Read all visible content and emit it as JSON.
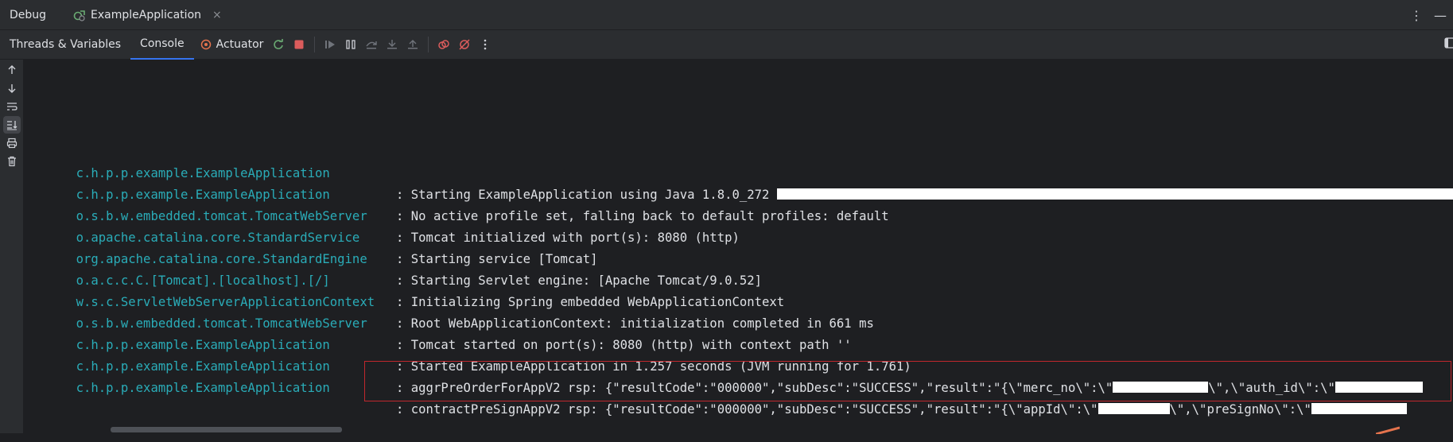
{
  "header": {
    "title": "Debug",
    "tab_label": "ExampleApplication",
    "tab_close": "×"
  },
  "toolbar": {
    "tabs": [
      "Threads & Variables",
      "Console"
    ],
    "actuator_label": "Actuator"
  },
  "console": {
    "lines": [
      {
        "logger": "c.h.p.p.example.ExampleApplication",
        "message": ": Starting ExampleApplication using Java 1.8.0_272 "
      },
      {
        "logger": "c.h.p.p.example.ExampleApplication",
        "message": ": No active profile set, falling back to default profiles: default"
      },
      {
        "logger": "o.s.b.w.embedded.tomcat.TomcatWebServer",
        "message": ": Tomcat initialized with port(s): 8080 (http)"
      },
      {
        "logger": "o.apache.catalina.core.StandardService",
        "message": ": Starting service [Tomcat]"
      },
      {
        "logger": "org.apache.catalina.core.StandardEngine",
        "message": ": Starting Servlet engine: [Apache Tomcat/9.0.52]"
      },
      {
        "logger": "o.a.c.c.C.[Tomcat].[localhost].[/]",
        "message": ": Initializing Spring embedded WebApplicationContext"
      },
      {
        "logger": "w.s.c.ServletWebServerApplicationContext",
        "message": ": Root WebApplicationContext: initialization completed in 661 ms"
      },
      {
        "logger": "o.s.b.w.embedded.tomcat.TomcatWebServer",
        "message": ": Tomcat started on port(s): 8080 (http) with context path ''"
      },
      {
        "logger": "c.h.p.p.example.ExampleApplication",
        "message": ": Started ExampleApplication in 1.257 seconds (JVM running for 1.761)"
      },
      {
        "logger": "c.h.p.p.example.ExampleApplication",
        "message_a": ": aggrPreOrderForAppV2 rsp: {\"resultCode\":\"000000\",\"subDesc\":\"SUCCESS\",\"result\":\"{\\\"merc_no\\\":\\\"",
        "message_b": "\\\",\\\"auth_id\\\":\\\""
      },
      {
        "logger": "c.h.p.p.example.ExampleApplication",
        "message_a": ": contractPreSignAppV2 rsp: {\"resultCode\":\"000000\",\"subDesc\":\"SUCCESS\",\"result\":\"{\\\"appId\\\":\\\"",
        "message_b": "\\\",\\\"preSignNo\\\":\\\""
      }
    ]
  },
  "colors": {
    "logger": "#2aacb8",
    "text": "#dfe1e5",
    "background": "#1e1f22",
    "panel": "#2b2d30",
    "highlight_border": "#c0272d",
    "accent": "#3574f0"
  }
}
